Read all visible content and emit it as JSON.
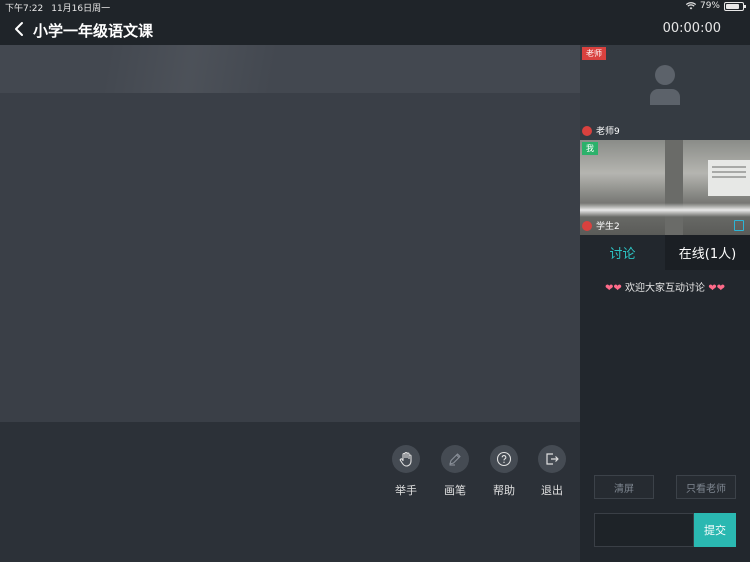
{
  "status_bar": {
    "time": "下午7:22",
    "date": "11月16日周一",
    "battery_percent": "79%",
    "battery_level": 0.79
  },
  "nav": {
    "title": "小学一年级语文课",
    "timer": "00:00:00"
  },
  "toolbar": {
    "items": [
      {
        "label": "举手",
        "icon": "raise-hand-icon"
      },
      {
        "label": "画笔",
        "icon": "pen-icon"
      },
      {
        "label": "帮助",
        "icon": "help-icon"
      },
      {
        "label": "退出",
        "icon": "exit-icon"
      }
    ]
  },
  "videos": {
    "teacher": {
      "tag": "老师",
      "name": "老师9"
    },
    "student": {
      "tag": "我",
      "name": "学生2"
    }
  },
  "tabs": [
    {
      "label": "讨论"
    },
    {
      "label": "在线(1人)"
    }
  ],
  "chat": {
    "welcome": "欢迎大家互动讨论",
    "clear_label": "清屏",
    "teacher_only_label": "只看老师",
    "submit_label": "提交",
    "input_value": ""
  },
  "colors": {
    "accent": "#2cc4c4",
    "submit": "#2ab8b1",
    "teacher_tag": "#d9413e",
    "me_tag": "#2cb16b"
  }
}
